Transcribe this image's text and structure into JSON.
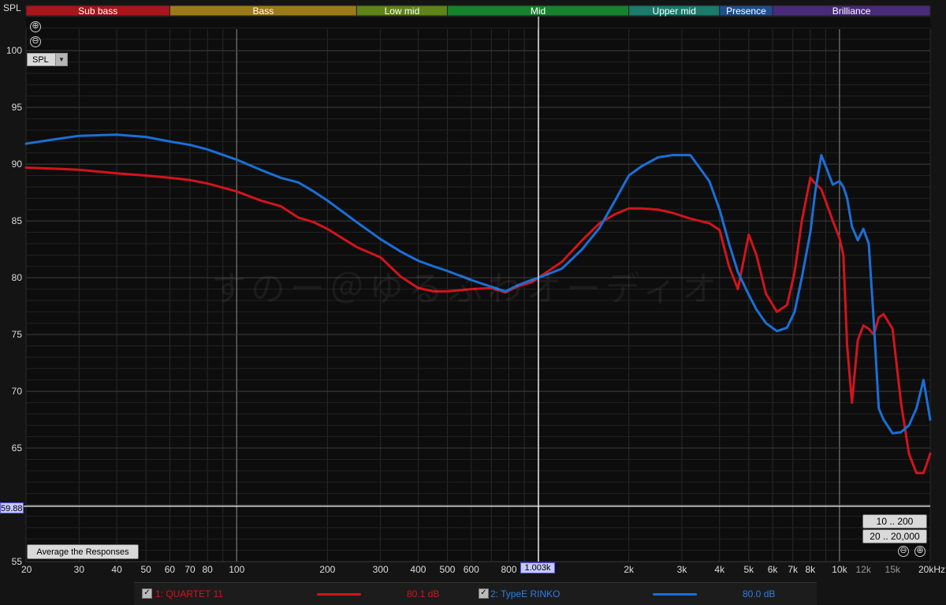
{
  "y_axis_label": "SPL",
  "display_mode": "SPL",
  "cursor": {
    "y_value": "59.88",
    "x_value": "1.003k"
  },
  "buttons": {
    "average": "Average the Responses",
    "range_10_200": "10 .. 200",
    "range_20_20000": "20 .. 20,000",
    "zoom_in": "⊕",
    "zoom_out": "⊖"
  },
  "watermark": "すのー＠ゆるふわオーディオ",
  "bands": [
    {
      "label": "Sub bass",
      "from": 20,
      "to": 60,
      "color": "#a8151b"
    },
    {
      "label": "Bass",
      "from": 60,
      "to": 250,
      "color": "#9c7a18"
    },
    {
      "label": "Low mid",
      "from": 250,
      "to": 500,
      "color": "#5f8418"
    },
    {
      "label": "Mid",
      "from": 500,
      "to": 2000,
      "color": "#17822c"
    },
    {
      "label": "Upper mid",
      "from": 2000,
      "to": 4000,
      "color": "#1a7a6c"
    },
    {
      "label": "Presence",
      "from": 4000,
      "to": 6000,
      "color": "#1d4f8c"
    },
    {
      "label": "Brilliance",
      "from": 6000,
      "to": 20000,
      "color": "#4a2a7a"
    }
  ],
  "legend": [
    {
      "checked": "✓",
      "name": "1: QUARTET 11",
      "value": "80.1 dB",
      "color": "#d2141c"
    },
    {
      "checked": "✓",
      "name": "2: TypeE RINKO",
      "value": "80.0 dB",
      "color": "#1a6fd6"
    }
  ],
  "chart_data": {
    "type": "line",
    "xscale": "log",
    "xlim": [
      20,
      20000
    ],
    "ylim": [
      55,
      103
    ],
    "x_tick_labels": [
      {
        "v": 20,
        "t": "20"
      },
      {
        "v": 30,
        "t": "30"
      },
      {
        "v": 40,
        "t": "40"
      },
      {
        "v": 50,
        "t": "50"
      },
      {
        "v": 60,
        "t": "60"
      },
      {
        "v": 70,
        "t": "70"
      },
      {
        "v": 80,
        "t": "80"
      },
      {
        "v": 100,
        "t": "100"
      },
      {
        "v": 200,
        "t": "200"
      },
      {
        "v": 300,
        "t": "300"
      },
      {
        "v": 400,
        "t": "400"
      },
      {
        "v": 500,
        "t": "500"
      },
      {
        "v": 600,
        "t": "600"
      },
      {
        "v": 800,
        "t": "800"
      },
      {
        "v": 2000,
        "t": "2k"
      },
      {
        "v": 3000,
        "t": "3k"
      },
      {
        "v": 4000,
        "t": "4k"
      },
      {
        "v": 5000,
        "t": "5k"
      },
      {
        "v": 6000,
        "t": "6k"
      },
      {
        "v": 7000,
        "t": "7k"
      },
      {
        "v": 8000,
        "t": "8k"
      },
      {
        "v": 10000,
        "t": "10k"
      },
      {
        "v": 12000,
        "t": "12k"
      },
      {
        "v": 15000,
        "t": "15k"
      },
      {
        "v": 20000,
        "t": "20kHz"
      }
    ],
    "y_ticks": [
      55,
      60,
      65,
      70,
      75,
      80,
      85,
      90,
      95,
      100
    ],
    "y_tick_labels": [
      "55",
      "",
      "65",
      "70",
      "75",
      "80",
      "85",
      "90",
      "95",
      "100"
    ],
    "cursor_freq": 1003,
    "cursor_db": 59.88,
    "series": [
      {
        "name": "1: QUARTET 11",
        "color": "#d2141c",
        "x": [
          20,
          25,
          30,
          40,
          50,
          60,
          70,
          80,
          100,
          120,
          140,
          160,
          180,
          200,
          250,
          300,
          350,
          400,
          450,
          500,
          600,
          700,
          780,
          850,
          950,
          1003,
          1200,
          1400,
          1600,
          1800,
          2000,
          2200,
          2500,
          2800,
          3200,
          3700,
          4000,
          4300,
          4600,
          5000,
          5300,
          5700,
          6200,
          6700,
          7100,
          7500,
          8000,
          8300,
          8700,
          9100,
          9500,
          10000,
          10300,
          10600,
          11000,
          11500,
          12000,
          12500,
          13000,
          13500,
          14000,
          15000,
          16000,
          17000,
          18000,
          19000,
          20000
        ],
        "y": [
          89.7,
          89.6,
          89.5,
          89.2,
          89.0,
          88.8,
          88.6,
          88.3,
          87.6,
          86.8,
          86.3,
          85.3,
          84.9,
          84.3,
          82.7,
          81.8,
          80.1,
          79.1,
          78.8,
          78.8,
          79.0,
          79.1,
          78.7,
          79.2,
          79.6,
          80.0,
          81.4,
          83.3,
          84.8,
          85.6,
          86.1,
          86.1,
          86.0,
          85.7,
          85.2,
          84.8,
          84.2,
          81.0,
          79.0,
          83.8,
          82.0,
          78.6,
          77.0,
          77.6,
          80.5,
          85.0,
          88.8,
          88.3,
          87.8,
          86.4,
          85.0,
          83.5,
          82.0,
          74.0,
          69.0,
          74.5,
          75.8,
          75.5,
          75.0,
          76.5,
          76.8,
          75.5,
          69.0,
          64.5,
          62.8,
          62.8,
          64.5
        ]
      },
      {
        "name": "2: TypeE RINKO",
        "color": "#1a6fd6",
        "x": [
          20,
          25,
          30,
          40,
          50,
          60,
          70,
          80,
          100,
          120,
          140,
          160,
          180,
          200,
          250,
          300,
          350,
          400,
          450,
          500,
          600,
          700,
          780,
          850,
          950,
          1003,
          1200,
          1400,
          1600,
          1800,
          2000,
          2200,
          2500,
          2800,
          3200,
          3700,
          4000,
          4300,
          4600,
          5000,
          5300,
          5700,
          6200,
          6700,
          7100,
          7500,
          8000,
          8300,
          8700,
          9100,
          9500,
          10000,
          10300,
          10600,
          11000,
          11500,
          12000,
          12500,
          13000,
          13500,
          14000,
          15000,
          16000,
          17000,
          18000,
          19000,
          20000
        ],
        "y": [
          91.8,
          92.2,
          92.5,
          92.6,
          92.4,
          92.0,
          91.7,
          91.3,
          90.4,
          89.5,
          88.8,
          88.4,
          87.6,
          86.8,
          84.9,
          83.4,
          82.3,
          81.5,
          81.0,
          80.6,
          79.8,
          79.2,
          78.8,
          79.3,
          79.8,
          80.0,
          80.8,
          82.5,
          84.4,
          86.8,
          89.0,
          89.8,
          90.6,
          90.8,
          90.8,
          88.5,
          86.0,
          83.0,
          80.5,
          78.5,
          77.2,
          76.0,
          75.3,
          75.6,
          77.0,
          80.0,
          84.0,
          87.5,
          90.8,
          89.5,
          88.2,
          88.5,
          88.0,
          87.0,
          84.5,
          83.3,
          84.3,
          83.0,
          76.0,
          68.5,
          67.5,
          66.3,
          66.4,
          67.0,
          68.5,
          71.0,
          67.5
        ]
      }
    ]
  }
}
